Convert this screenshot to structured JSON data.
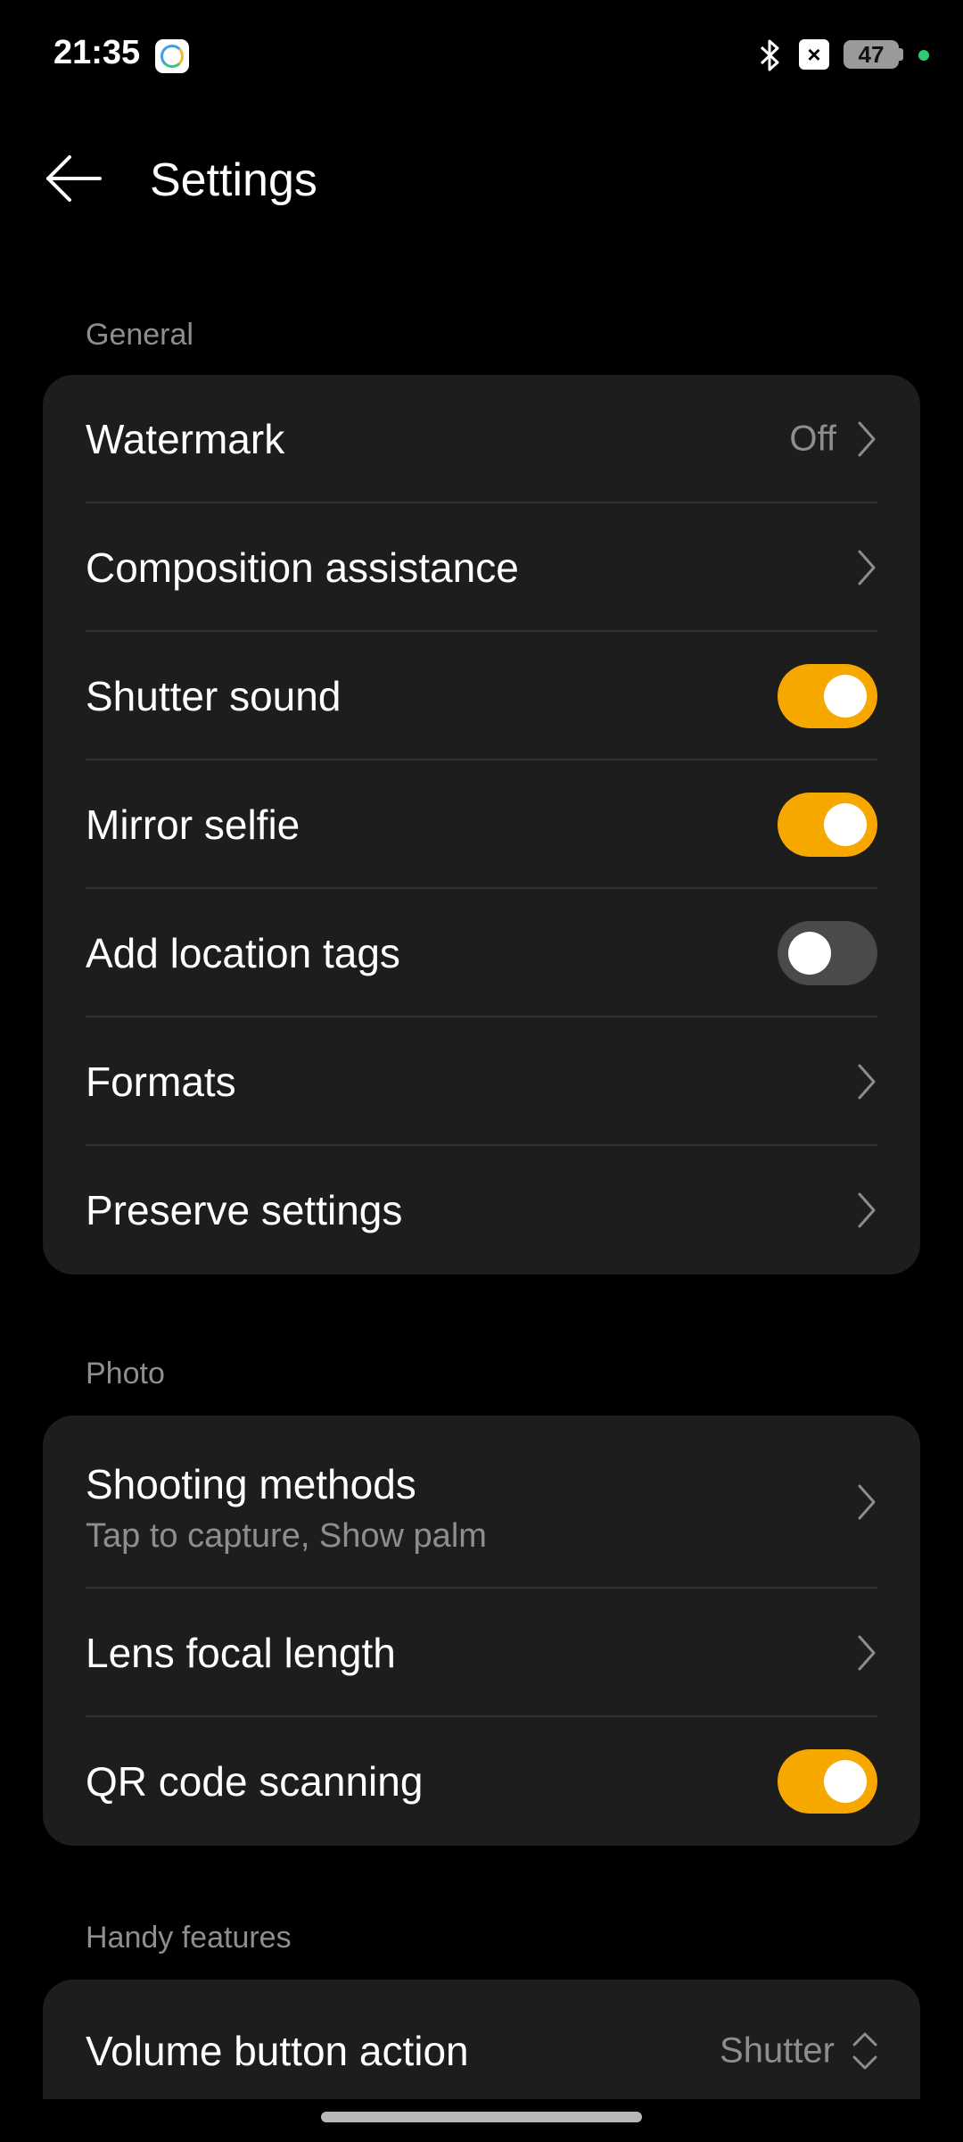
{
  "status_bar": {
    "time": "21:35",
    "battery": "47"
  },
  "header": {
    "title": "Settings"
  },
  "sections": {
    "general": {
      "label": "General",
      "watermark": {
        "label": "Watermark",
        "value": "Off"
      },
      "composition": {
        "label": "Composition assistance"
      },
      "shutter_sound": {
        "label": "Shutter sound",
        "on": true
      },
      "mirror_selfie": {
        "label": "Mirror selfie",
        "on": true
      },
      "location_tags": {
        "label": "Add location tags",
        "on": false
      },
      "formats": {
        "label": "Formats"
      },
      "preserve": {
        "label": "Preserve settings"
      }
    },
    "photo": {
      "label": "Photo",
      "shooting_methods": {
        "label": "Shooting methods",
        "sub": "Tap to capture, Show palm"
      },
      "lens_focal": {
        "label": "Lens focal length"
      },
      "qr_scanning": {
        "label": "QR code scanning",
        "on": true
      }
    },
    "handy": {
      "label": "Handy features",
      "volume_button": {
        "label": "Volume button action",
        "value": "Shutter"
      }
    }
  },
  "colors": {
    "accent": "#f7a800",
    "card": "#1d1d1d",
    "background": "#000000",
    "secondary_text": "#8e8e8e"
  }
}
